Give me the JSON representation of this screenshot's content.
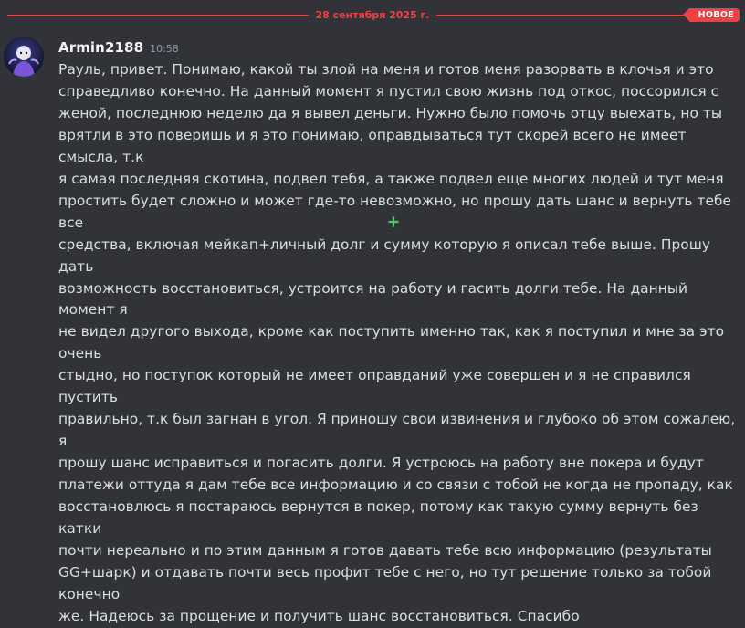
{
  "divider": {
    "date": "28 сентября 2025 г.",
    "badge": "НОВОЕ"
  },
  "message": {
    "username": "Armin2188",
    "timestamp": "10:58",
    "text": "Рауль, привет. Понимаю, какой ты злой на меня и готов меня разорвать в клочья и это\nсправедливо конечно. На данный момент я пустил свою жизнь под откос, поссорился с\nженой, последнюю неделю да я вывел деньги. Нужно было помочь отцу выехать, но ты\nврятли в это поверишь и я это понимаю, оправдываться тут скорей всего не имеет смысла, т.к\nя самая последняя скотина, подвел тебя, а также подвел еще многих людей и тут меня\nпростить будет сложно и может где-то невозможно, но прошу дать шанс и вернуть тебе все\nсредства, включая мейкап+личный долг и сумму которую я описал тебе выше. Прошу дать\nвозможность восстановиться, устроится на работу и гасить долги тебе. На данный момент я\nне видел другого выхода, кроме как поступить именно так, как я поступил и мне за это очень\nстыдно, но поступок который не имеет оправданий уже совершен и я не справился пустить\nправильно, т.к был загнан в угол. Я приношу свои извинения и глубоко об этом сожалею, я\nпрошу шанс исправиться и погасить долги. Я устроюсь на работу вне покера и будут\nплатежи оттуда я дам тебе все информацию и со связи с тобой не когда не пропаду, как\nвосстановлюсь я  постараюсь вернутся в покер, потому как такую сумму вернуть без катки\nпочти нереально и по этим данным я готов давать тебе всю информацию (результаты\nGG+шарк) и отдавать почти весь профит тебе с него, но тут решение только за тобой конечно\nже. Надеюсь за прощение и получить шанс восстановиться. Спасибо"
  },
  "colors": {
    "background": "#313338",
    "new_divider": "#f23f43",
    "text": "#dbdee1",
    "username": "#f2f3f5",
    "timestamp": "#949ba4"
  },
  "icons": {
    "cursor": "pointer-cursor-icon"
  }
}
